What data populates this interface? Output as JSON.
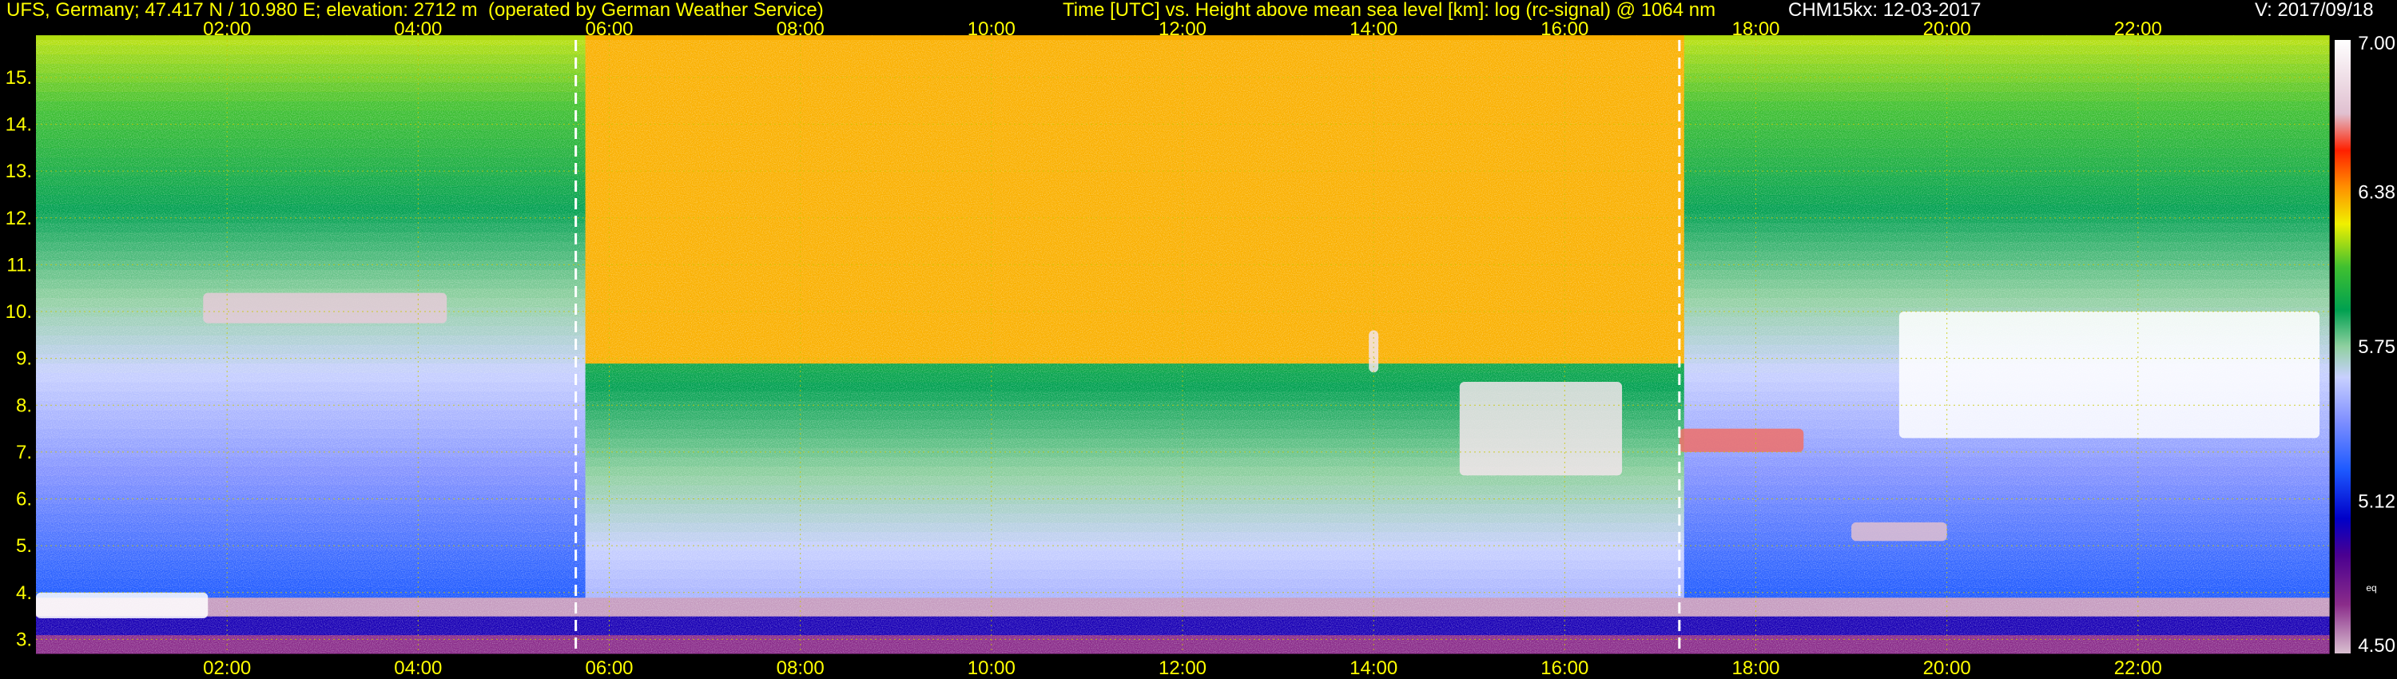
{
  "header": {
    "station": "UFS, Germany; 47.417 N / 10.980 E; elevation: 2712 m  (operated by German Weather Service)",
    "axes_title": "Time [UTC] vs. Height above mean sea level [km]: log (rc-signal) @ 1064 nm",
    "instrument": "CHM15kx: 12-03-2017",
    "version": "V: 2017/09/18"
  },
  "colors": {
    "text": "#ffff00",
    "gridline": "#c8c800",
    "marker_line": "#ffffff",
    "background": "#000000"
  },
  "chart_data": {
    "type": "heatmap",
    "title": "Time [UTC] vs. Height above mean sea level [km]: log (rc-signal) @ 1064 nm",
    "xlabel": "Time [UTC]",
    "ylabel": "Height above mean sea level [km]",
    "x_tick_labels": [
      "02:00",
      "04:00",
      "06:00",
      "08:00",
      "10:00",
      "12:00",
      "14:00",
      "16:00",
      "18:00",
      "20:00",
      "22:00"
    ],
    "x_ticks_hours": [
      2,
      4,
      6,
      8,
      10,
      12,
      14,
      16,
      18,
      20,
      22
    ],
    "xlim_hours": [
      0.0,
      24.0
    ],
    "y_tick_labels": [
      "3.",
      "4.",
      "5.",
      "6.",
      "7.",
      "8.",
      "9.",
      "10.",
      "11.",
      "12.",
      "13.",
      "14.",
      "15."
    ],
    "y_ticks_km": [
      3,
      4,
      5,
      6,
      7,
      8,
      9,
      10,
      11,
      12,
      13,
      14,
      15
    ],
    "ylim_km": [
      2.7,
      15.8
    ],
    "grid": true,
    "dashed_markers_hours": [
      5.65,
      17.2
    ],
    "colorbar": {
      "range": [
        4.5,
        7.0
      ],
      "tick_values": [
        7.0,
        6.38,
        5.75,
        5.12,
        4.5
      ],
      "tick_labels": [
        "7.00",
        "6.38",
        "5.75",
        "5.12",
        "4.50"
      ],
      "stops": [
        [
          0.0,
          "#d9c0d0"
        ],
        [
          0.08,
          "#8a2c8a"
        ],
        [
          0.16,
          "#4a0090"
        ],
        [
          0.22,
          "#0000c8"
        ],
        [
          0.3,
          "#1e5aff"
        ],
        [
          0.38,
          "#8090ff"
        ],
        [
          0.45,
          "#c8d0ff"
        ],
        [
          0.5,
          "#90d0a0"
        ],
        [
          0.56,
          "#00a050"
        ],
        [
          0.63,
          "#40c030"
        ],
        [
          0.7,
          "#f0f000"
        ],
        [
          0.76,
          "#ff9000"
        ],
        [
          0.82,
          "#ff2000"
        ],
        [
          0.88,
          "#e0c0d0"
        ],
        [
          1.0,
          "#ffffff"
        ]
      ],
      "side_label": "eq"
    },
    "clouds": [
      {
        "t0": 1.75,
        "t1": 4.3,
        "h0": 9.75,
        "h1": 10.4,
        "level": 0.9
      },
      {
        "t0": 0.0,
        "t1": 1.8,
        "h0": 3.45,
        "h1": 4.0,
        "level": 1.0
      },
      {
        "t0": 13.95,
        "t1": 14.05,
        "h0": 8.7,
        "h1": 9.6,
        "level": 0.95
      },
      {
        "t0": 14.9,
        "t1": 16.6,
        "h0": 6.5,
        "h1": 8.5,
        "level": 0.95
      },
      {
        "t0": 17.2,
        "t1": 18.5,
        "h0": 7.0,
        "h1": 7.5,
        "level": 0.85
      },
      {
        "t0": 19.0,
        "t1": 20.0,
        "h0": 5.1,
        "h1": 5.5,
        "level": 0.88
      },
      {
        "t0": 19.5,
        "t1": 23.9,
        "h0": 7.3,
        "h1": 10.0,
        "level": 1.0
      }
    ]
  }
}
